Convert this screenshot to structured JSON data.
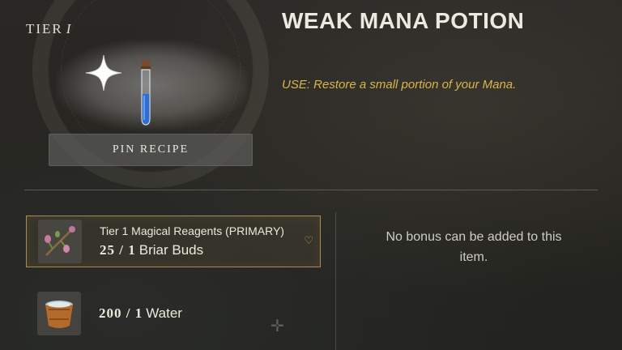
{
  "recipe": {
    "tier_label": "TIER",
    "tier_number": "I",
    "pin_button": "PIN RECIPE",
    "item_name": "WEAK MANA POTION",
    "use_text": "USE: Restore a small portion of your Mana."
  },
  "ingredients": [
    {
      "label": "Tier 1 Magical Reagents (PRIMARY)",
      "quantity": "25 / 1",
      "name": "Briar Buds",
      "icon": "briar-buds-icon",
      "selected": true
    },
    {
      "label": "",
      "quantity": "200 / 1",
      "name": "Water",
      "icon": "water-bucket-icon",
      "selected": false
    }
  ],
  "bonus": {
    "message": "No bonus can be added to this item."
  },
  "colors": {
    "use_text": "#d8b64a",
    "selected_border": "#a98a55",
    "potion_blue": "#2f6fd0"
  }
}
